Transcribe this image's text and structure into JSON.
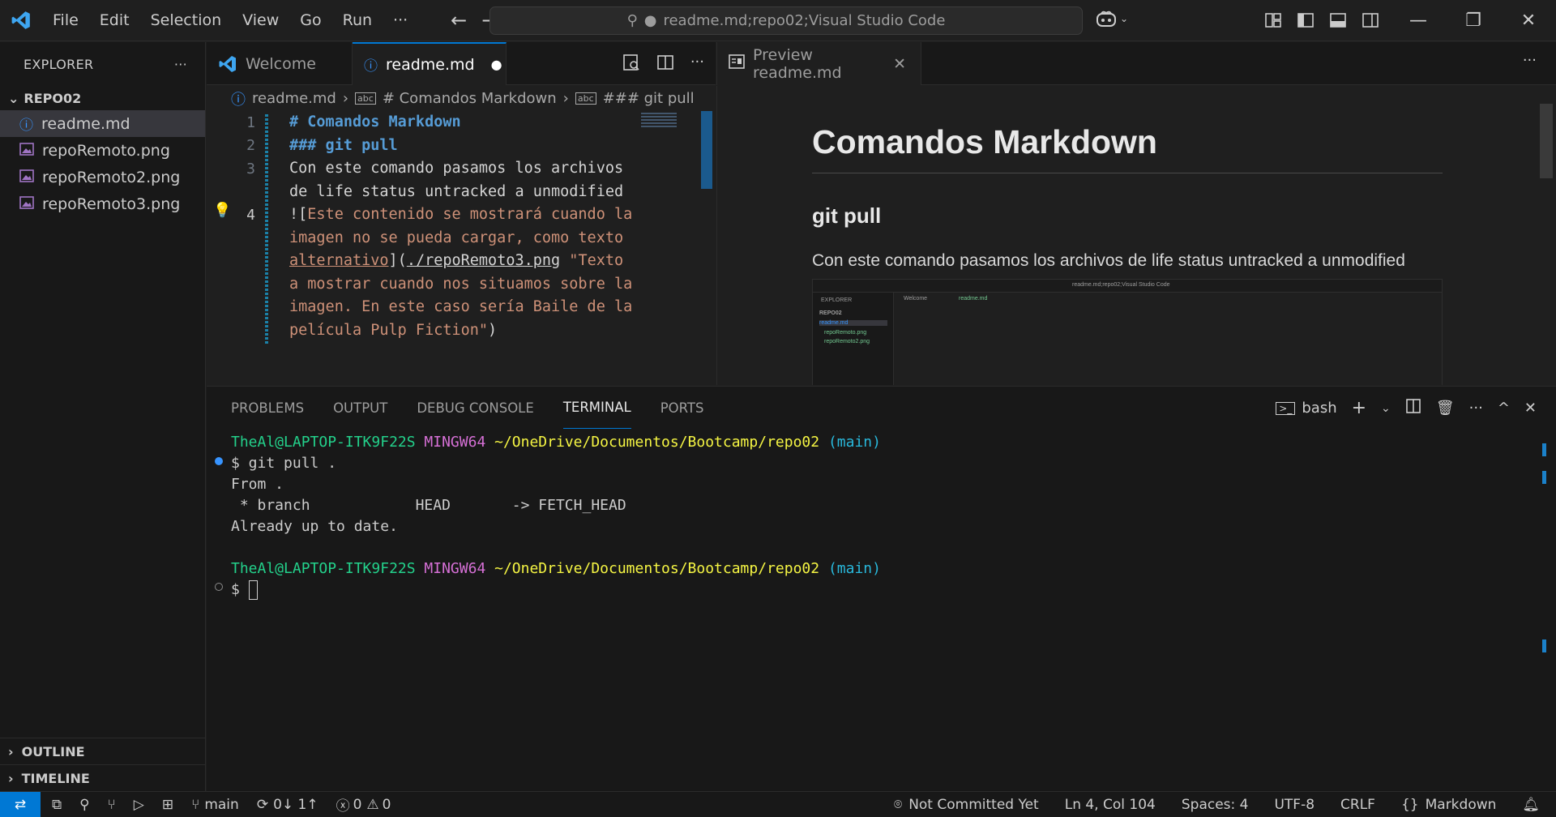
{
  "colors": {
    "accent": "#0078d4",
    "heading": "#569cd6",
    "string": "#ce9178"
  },
  "titlebar": {
    "menu": [
      "File",
      "Edit",
      "Selection",
      "View",
      "Go",
      "Run",
      "···"
    ],
    "command_center": "readme.md;repo02;Visual Studio Code"
  },
  "sidebar": {
    "title": "EXPLORER",
    "folder": "REPO02",
    "files": [
      "readme.md",
      "repoRemoto.png",
      "repoRemoto2.png",
      "repoRemoto3.png"
    ],
    "sections": [
      "OUTLINE",
      "TIMELINE"
    ]
  },
  "editor": {
    "tabs": [
      "Welcome",
      "readme.md"
    ],
    "breadcrumb": [
      "readme.md",
      "# Comandos Markdown",
      "### git pull"
    ],
    "line_numbers": [
      "1",
      "2",
      "3",
      "4"
    ],
    "lines": {
      "l1": "# Comandos Markdown",
      "l2": "### git pull",
      "l3a": "Con este comando pasamos los archivos",
      "l3b": "de life status untracked a unmodified",
      "l4a_open": "![",
      "l4a": "Este contenido se mostrará cuando la",
      "l4b": "imagen no se pueda cargar, como texto",
      "l4c_alt": "alternativo",
      "l4c_mid": "](",
      "l4c_url": "./repoRemoto3.png",
      "l4c_str": " \"Texto",
      "l4d": "a mostrar cuando nos situamos sobre la",
      "l4e": "imagen. En este caso sería Baile de la",
      "l4f": "película Pulp Fiction\"",
      "l4f_close": ")"
    }
  },
  "preview": {
    "tab": "Preview readme.md",
    "h1": "Comandos Markdown",
    "h3": "git pull",
    "paragraph": "Con este comando pasamos los archivos de life status untracked a unmodified",
    "image": {
      "command_center": "readme.md;repo02;Visual Studio Code",
      "explorer": "EXPLORER",
      "folder": "REPO02",
      "files": [
        "readme.md",
        "repoRemoto.png",
        "repoRemoto2.png"
      ],
      "tabs": [
        "Welcome",
        "readme.md"
      ]
    }
  },
  "panel": {
    "tabs": [
      "PROBLEMS",
      "OUTPUT",
      "DEBUG CONSOLE",
      "TERMINAL",
      "PORTS"
    ],
    "shell": "bash",
    "terminal": {
      "user": "TheAl@LAPTOP-ITK9F22S",
      "env": "MINGW64",
      "path": "~/OneDrive/Documentos/Bootcamp/repo02",
      "branch": "(main)",
      "prompt": "$",
      "command": " git pull .",
      "out1": "From .",
      "out2": " * branch            HEAD       -> FETCH_HEAD",
      "out3": "Already up to date."
    }
  },
  "statusbar": {
    "branch": "main",
    "sync": "0↓ 1↑",
    "errors": "0",
    "warnings": "0",
    "commit": "Not Committed Yet",
    "position": "Ln 4, Col 104",
    "spaces": "Spaces: 4",
    "encoding": "UTF-8",
    "eol": "CRLF",
    "language": "Markdown"
  }
}
